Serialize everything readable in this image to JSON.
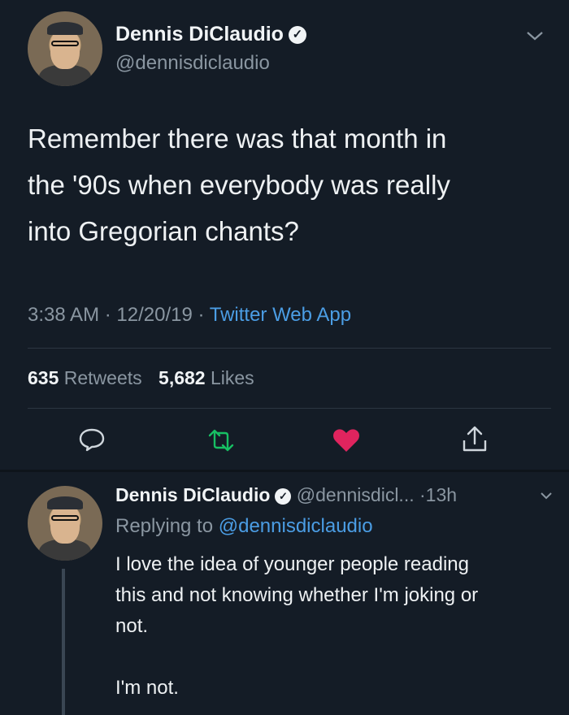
{
  "main_tweet": {
    "display_name": "Dennis DiClaudio",
    "handle": "@dennisdiclaudio",
    "text_lines": [
      "Remember there was that month in",
      "the '90s when everybody was really",
      "into Gregorian chants?"
    ],
    "time": "3:38 AM",
    "date": "12/20/19",
    "source": "Twitter Web App",
    "retweets_count": "635",
    "retweets_label": "Retweets",
    "likes_count": "5,682",
    "likes_label": "Likes"
  },
  "reply": {
    "display_name": "Dennis DiClaudio",
    "handle": "@dennisdicl...",
    "age": "13h",
    "replying_to_label": "Replying to",
    "replying_to_handle": "@dennisdiclaudio",
    "lines": [
      "I love the idea of younger people reading",
      "this and not knowing whether I'm joking or",
      "not.",
      "",
      "I'm not."
    ]
  },
  "icons": {
    "verified": "verified-badge-icon",
    "chevron": "chevron-down-icon",
    "reply": "reply-icon",
    "retweet": "retweet-icon",
    "like": "heart-icon",
    "share": "share-icon"
  },
  "colors": {
    "background": "#141c26",
    "link": "#4b9de4",
    "retweet_green": "#17bf63",
    "like_red": "#e0245e"
  }
}
